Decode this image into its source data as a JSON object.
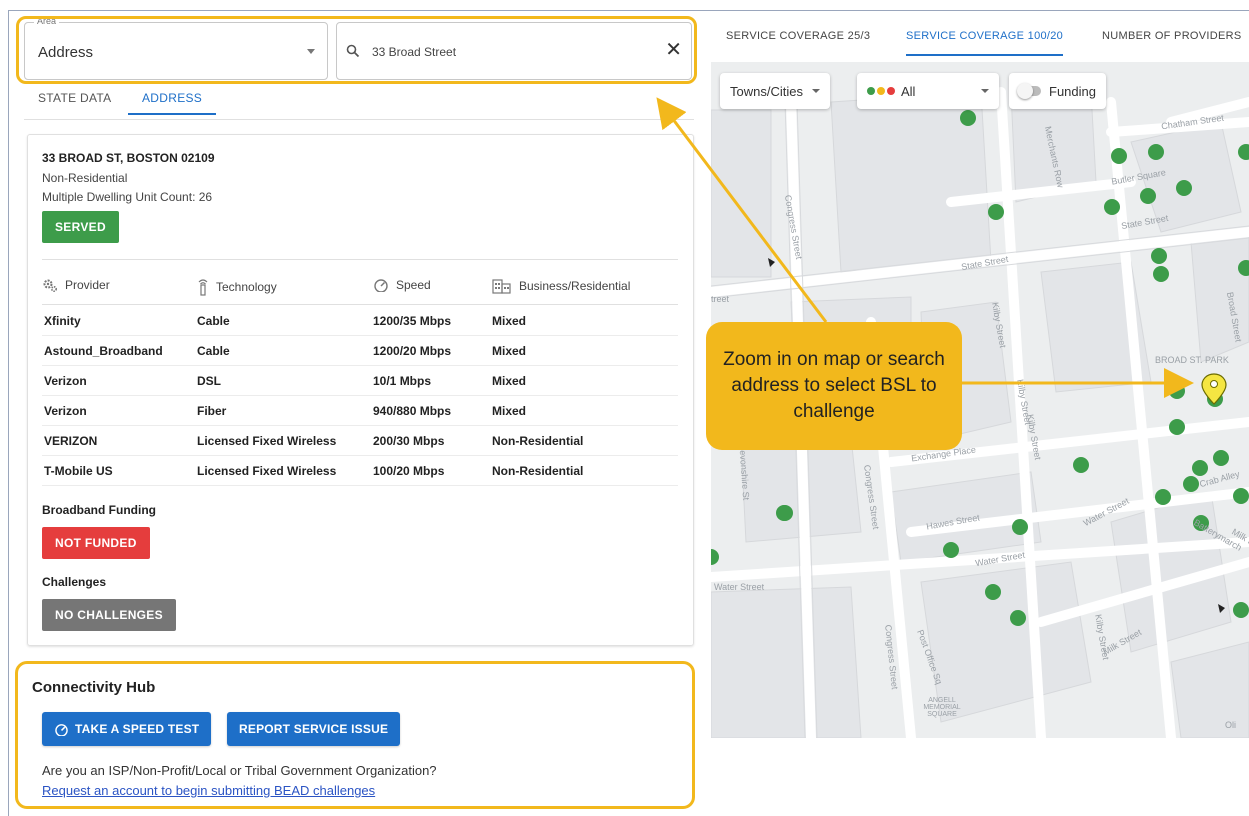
{
  "search": {
    "area_label": "Area",
    "area_value": "Address",
    "address_value": "33 Broad Street"
  },
  "left_tabs": [
    {
      "label": "STATE DATA",
      "active": false
    },
    {
      "label": "ADDRESS",
      "active": true
    }
  ],
  "location": {
    "title": "33 BROAD ST, BOSTON 02109",
    "type": "Non-Residential",
    "dwelling": "Multiple Dwelling Unit Count: 26",
    "status": "SERVED"
  },
  "providers_table": {
    "headers": [
      "Provider",
      "Technology",
      "Speed",
      "Business/Residential"
    ],
    "header_icons": [
      "gears-icon",
      "antenna-icon",
      "speedometer-icon",
      "buildings-icon"
    ],
    "rows": [
      [
        "Xfinity",
        "Cable",
        "1200/35 Mbps",
        "Mixed"
      ],
      [
        "Astound_Broadband",
        "Cable",
        "1200/20 Mbps",
        "Mixed"
      ],
      [
        "Verizon",
        "DSL",
        "10/1 Mbps",
        "Mixed"
      ],
      [
        "Verizon",
        "Fiber",
        "940/880 Mbps",
        "Mixed"
      ],
      [
        "VERIZON",
        "Licensed Fixed Wireless",
        "200/30 Mbps",
        "Non-Residential"
      ],
      [
        "T-Mobile US",
        "Licensed Fixed Wireless",
        "100/20 Mbps",
        "Non-Residential"
      ]
    ]
  },
  "funding": {
    "label": "Broadband Funding",
    "status": "NOT FUNDED"
  },
  "challenges": {
    "label": "Challenges",
    "status": "NO CHALLENGES"
  },
  "hub": {
    "title": "Connectivity Hub",
    "speed_test": "TAKE A SPEED TEST",
    "report_issue": "REPORT SERVICE ISSUE",
    "question": "Are you an ISP/Non-Profit/Local or Tribal Government Organization?",
    "link": "Request an account to begin submitting BEAD challenges"
  },
  "map_tabs": [
    {
      "label": "SERVICE COVERAGE 25/3",
      "active": false
    },
    {
      "label": "SERVICE COVERAGE 100/20",
      "active": true
    },
    {
      "label": "NUMBER OF PROVIDERS",
      "active": false
    }
  ],
  "map_controls": {
    "towns": "Towns/Cities",
    "filter": "All",
    "filter_dot_colors": [
      "#3d9c4a",
      "#f2b81c",
      "#e53d3d"
    ],
    "funding": "Funding"
  },
  "map_streets": {
    "chatham": "Chatham Street",
    "butler": "Butler Square",
    "state1": "State Street",
    "state2": "State Street",
    "congress1": "Congress Street",
    "congress2": "Congress Street",
    "congress3": "Congress Street",
    "merchants": "Merchants Row",
    "kilby1": "Kilby Street",
    "kilby2": "Kilby Street",
    "kilby3": "Kilby Street",
    "kilby4": "Kilby Street",
    "broad": "Broad Street",
    "broad_park": "BROAD ST. PARK",
    "exchange": "Exchange Place",
    "devonshire": "Devonshire St",
    "hawes": "Hawes Street",
    "water1": "Water Street",
    "water2": "Water Street",
    "water3": "Water Street",
    "crab": "Crab Alley",
    "battery": "Batterymarch",
    "milk": "Milk Street",
    "milk2": "Milk S",
    "post_office": "Post Office Sq",
    "angell": "ANGELL MEMORIAL SQUARE",
    "street_left": "treet",
    "oli": "Oli"
  },
  "map_colors": {
    "served_dot": "#3d9c4a",
    "pin": "#f5e642"
  },
  "callout": {
    "text": "Zoom in on map or search address to select BSL to challenge"
  }
}
